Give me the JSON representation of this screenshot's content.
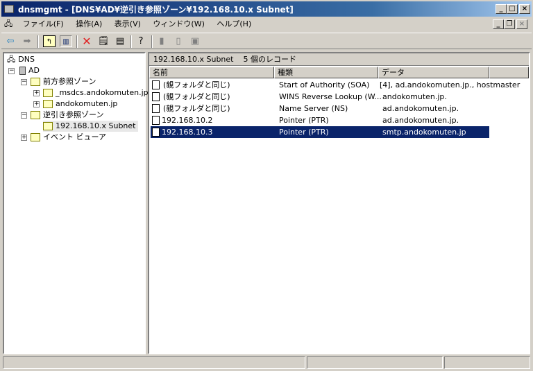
{
  "window": {
    "title": "dnsmgmt - [DNS¥AD¥逆引き参照ゾーン¥192.168.10.x Subnet]"
  },
  "menu": [
    "ファイル(F)",
    "操作(A)",
    "表示(V)",
    "ウィンドウ(W)",
    "ヘルプ(H)"
  ],
  "tree": {
    "root": "DNS",
    "server": "AD",
    "forward": "前方参照ゾーン",
    "fz1": "_msdcs.andokomuten.jp",
    "fz2": "andokomuten.jp",
    "reverse": "逆引き参照ゾーン",
    "rz1": "192.168.10.x Subnet",
    "events": "イベント ビューア"
  },
  "header": {
    "zone": "192.168.10.x Subnet",
    "count": "5 個のレコード"
  },
  "columns": [
    "名前",
    "種類",
    "データ"
  ],
  "rows": [
    {
      "name": "(親フォルダと同じ)",
      "type": "Start of Authority (SOA)",
      "data": "[4], ad.andokomuten.jp., hostmaster"
    },
    {
      "name": "(親フォルダと同じ)",
      "type": "WINS Reverse Lookup (W...",
      "data": "andokomuten.jp."
    },
    {
      "name": "(親フォルダと同じ)",
      "type": "Name Server (NS)",
      "data": "ad.andokomuten.jp."
    },
    {
      "name": "192.168.10.2",
      "type": "Pointer (PTR)",
      "data": "ad.andokomuten.jp."
    },
    {
      "name": "192.168.10.3",
      "type": "Pointer (PTR)",
      "data": "smtp.andokomuten.jp",
      "selected": true
    }
  ]
}
